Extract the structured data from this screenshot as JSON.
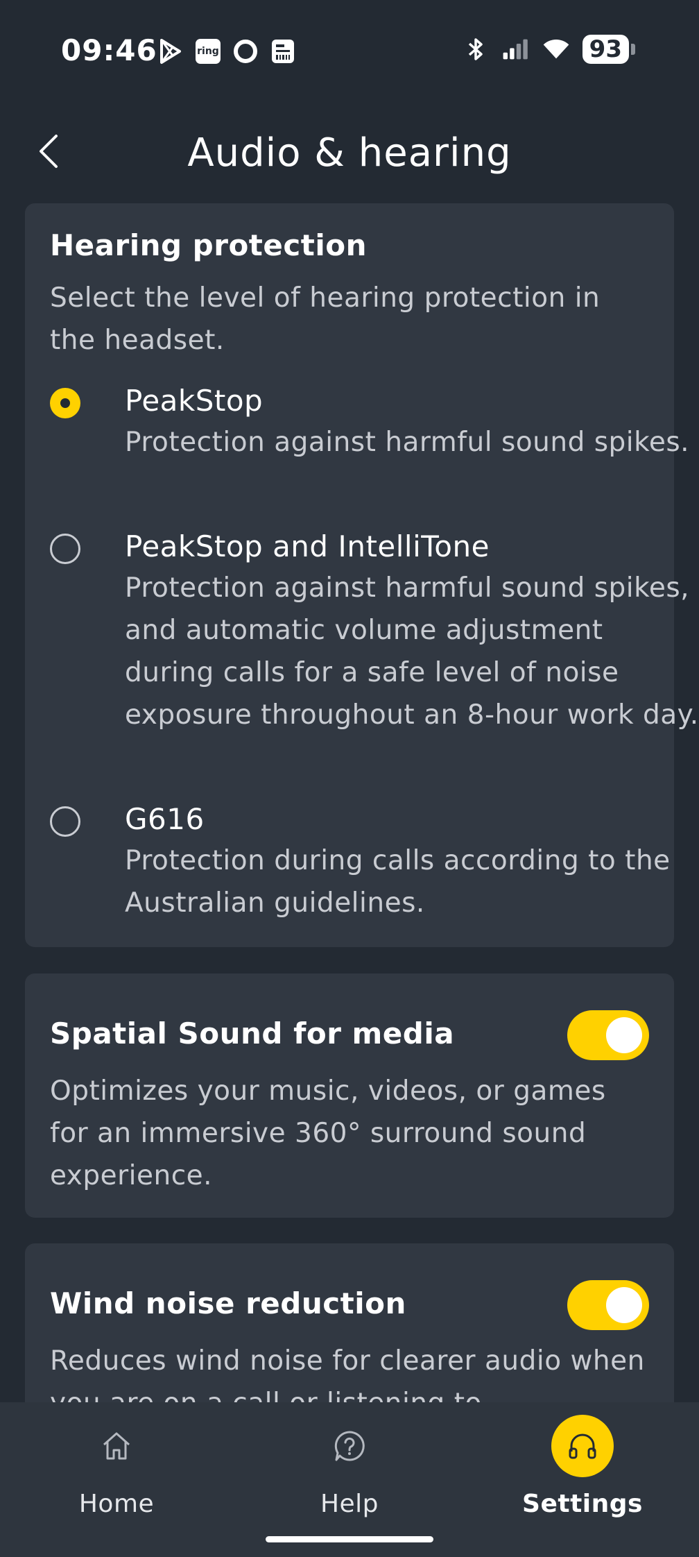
{
  "status_bar": {
    "time": "09:46",
    "left_icons": [
      "play-store-icon",
      "ring-icon",
      "circle-app-icon",
      "document-app-icon"
    ],
    "ring_label": "ring",
    "right_icons": [
      "bluetooth-icon",
      "signal-icon",
      "wifi-icon"
    ],
    "battery": "93"
  },
  "header": {
    "title": "Audio & hearing",
    "back_icon": "chevron-left-icon"
  },
  "hearing_protection": {
    "title": "Hearing protection",
    "description": "Select the level of hearing protection in the headset.",
    "options": [
      {
        "label": "PeakStop",
        "description": "Protection against harmful sound spikes.",
        "selected": true
      },
      {
        "label": "PeakStop and IntelliTone",
        "description": "Protection against harmful sound spikes, and automatic volume adjustment during calls for a safe level of noise exposure throughout an 8-hour work day.",
        "selected": false
      },
      {
        "label": "G616",
        "description": "Protection during calls according to the Australian guidelines.",
        "selected": false
      }
    ]
  },
  "spatial_sound": {
    "title": "Spatial Sound for media",
    "description": "Optimizes your music, videos, or games for an immersive 360° surround sound experience.",
    "enabled": true
  },
  "wind_noise": {
    "title": "Wind noise reduction",
    "description": "Reduces wind noise for clearer audio when you are on a call or listening to",
    "enabled": true
  },
  "bottom_nav": {
    "items": [
      {
        "label": "Home",
        "icon": "home-icon",
        "active": false
      },
      {
        "label": "Help",
        "icon": "help-icon",
        "active": false
      },
      {
        "label": "Settings",
        "icon": "headphones-icon",
        "active": true
      }
    ]
  },
  "colors": {
    "background": "#232a33",
    "card": "#313842",
    "accent": "#ffd100",
    "nav_background": "#2e353e"
  }
}
